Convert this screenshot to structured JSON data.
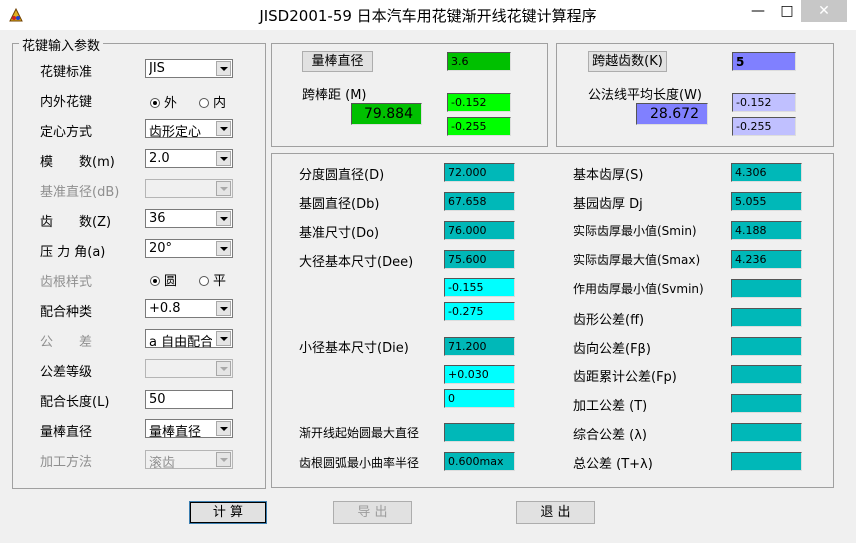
{
  "window": {
    "title": "JISD2001-59 日本汽车用花键渐开线花键计算程序",
    "minimize": "—",
    "maximize": "□",
    "close": "✕"
  },
  "input_group": {
    "legend": "花键输入参数",
    "spline_standard": {
      "label": "花键标准",
      "value": "JIS"
    },
    "inner_outer": {
      "label": "内外花键",
      "opt1": "外",
      "opt2": "内",
      "selected": "外"
    },
    "centering": {
      "label": "定心方式",
      "value": "齿形定心"
    },
    "module": {
      "label": "模　　数(m)",
      "value": "2.0"
    },
    "base_dia": {
      "label": "基准直径(dB)",
      "value": ""
    },
    "teeth": {
      "label": "齿　　数(Z)",
      "value": "36"
    },
    "pressure_angle": {
      "label": "压 力 角(a)",
      "value": "20°"
    },
    "root_style": {
      "label": "齿根样式",
      "opt1": "圆",
      "opt2": "平",
      "selected": "圆"
    },
    "fit_type": {
      "label": "配合种类",
      "value": "+0.8"
    },
    "tolerance": {
      "label": "公　　差",
      "value": "a 自由配合"
    },
    "tol_grade": {
      "label": "公差等级",
      "value": ""
    },
    "fit_length": {
      "label": "配合长度(L)",
      "value": "50"
    },
    "pin_dia": {
      "label": "量棒直径",
      "value": "量棒直径"
    },
    "method": {
      "label": "加工方法",
      "value": "滚齿"
    }
  },
  "pin_panel": {
    "button": "量棒直径",
    "pin_value": "3.6",
    "distance_label": "跨棒距 (M)",
    "distance": "79.884",
    "tol_upper": "-0.152",
    "tol_lower": "-0.255"
  },
  "span_panel": {
    "button": "跨越齿数(K)",
    "count": "5",
    "length_label": "公法线平均长度(W)",
    "length": "28.672",
    "tol_upper": "-0.152",
    "tol_lower": "-0.255"
  },
  "results": {
    "pitch_dia": {
      "label": "分度圆直径(D)",
      "value": "72.000"
    },
    "base_circle": {
      "label": "基圆直径(Db)",
      "value": "67.658"
    },
    "ref_size": {
      "label": "基准尺寸(Do)",
      "value": "76.000"
    },
    "major_dia": {
      "label": "大径基本尺寸(Dee)",
      "value": "75.600",
      "tol1": "-0.155",
      "tol2": "-0.275"
    },
    "minor_dia": {
      "label": "小径基本尺寸(Die)",
      "value": "71.200",
      "tol1": "+0.030",
      "tol2": "0"
    },
    "involute_start": {
      "label": "渐开线起始圆最大直径",
      "value": ""
    },
    "root_radius": {
      "label": "齿根圆弧最小曲率半径",
      "value": "0.600max"
    },
    "basic_thickness": {
      "label": "基本齿厚(S)",
      "value": "4.306"
    },
    "base_thickness": {
      "label": "基园齿厚 Dj",
      "value": "5.055"
    },
    "min_thickness": {
      "label": "实际齿厚最小值(Smin)",
      "value": "4.188"
    },
    "max_thickness": {
      "label": "实际齿厚最大值(Smax)",
      "value": "4.236"
    },
    "eff_min_thickness": {
      "label": "作用齿厚最小值(Svmin)",
      "value": ""
    },
    "profile_tol": {
      "label": "齿形公差(ff)",
      "value": ""
    },
    "lead_tol": {
      "label": "齿向公差(Fβ)",
      "value": ""
    },
    "pitch_cum_tol": {
      "label": "齿距累计公差(Fp)",
      "value": ""
    },
    "machining_tol": {
      "label": "加工公差 (T)",
      "value": ""
    },
    "comp_tol": {
      "label": "综合公差 (λ)",
      "value": ""
    },
    "total_tol": {
      "label": "总公差 (T+λ)",
      "value": ""
    }
  },
  "buttons": {
    "calc": "计 算",
    "export": "导 出",
    "exit": "退 出"
  },
  "colors": {
    "teal": "#00b8b8",
    "cyan": "#00ffff",
    "green": "#00ff00",
    "blue": "#8080ff",
    "lavender": "#c0c0ff"
  }
}
